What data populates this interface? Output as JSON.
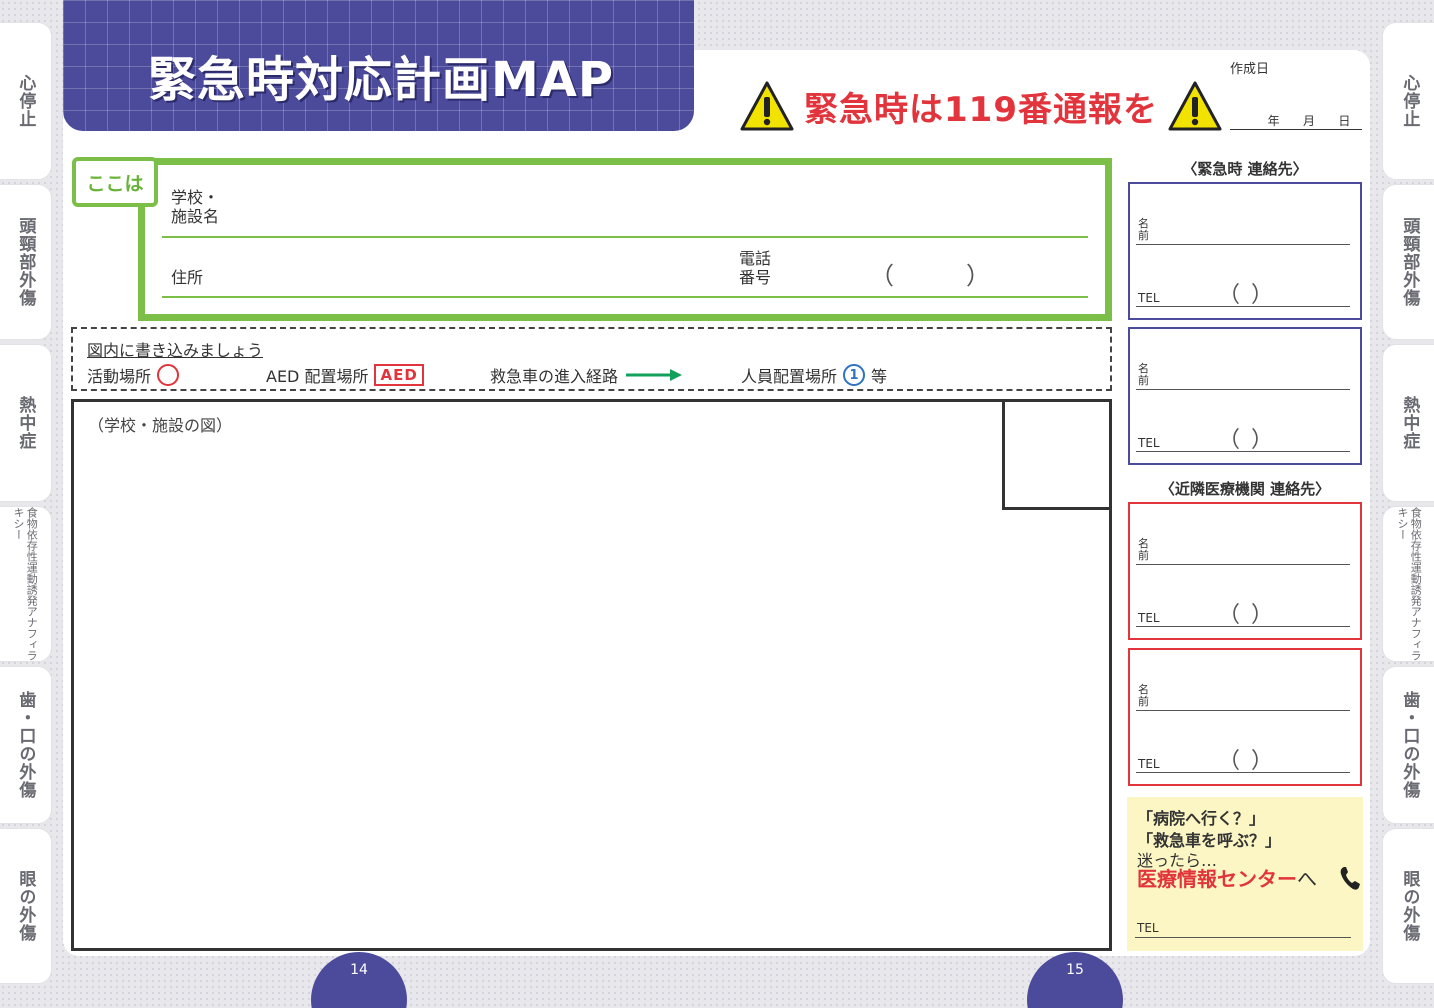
{
  "title": "緊急時対応計画MAP",
  "warning_text": "緊急時は119番通報を",
  "created_label": "作成日",
  "date_units": [
    "年",
    "月",
    "日"
  ],
  "left_tabs": [
    "心停止",
    "頭頸部外傷",
    "熱中症",
    "食物依存性運動誘発アナフィラキシー",
    "歯・口の外傷",
    "眼の外傷"
  ],
  "right_tabs": [
    "心停止",
    "頭頸部外傷",
    "熱中症",
    "食物依存性運動誘発アナフィラキシー",
    "歯・口の外傷",
    "眼の外傷"
  ],
  "location": {
    "tag": "ここは",
    "school_label_1": "学校・",
    "school_label_2": "施設名",
    "address_label": "住所",
    "phone_label_1": "電話",
    "phone_label_2": "番号",
    "phone_paren_open": "（",
    "phone_paren_close": "）"
  },
  "legend": {
    "title": "図内に書き込みましょう",
    "activity": "活動場所",
    "aed_place": "AED 配置場所",
    "aed_badge": "AED",
    "ambulance_route": "救急車の進入経路",
    "staff_place": "人員配置場所",
    "staff_number": "1",
    "staff_suffix": "等"
  },
  "map_label": "（学校・施設の図）",
  "emergency_contacts_heading": "〈緊急時 連絡先〉",
  "medical_contacts_heading": "〈近隣医療機関 連絡先〉",
  "contact_box": {
    "name_label": "名前",
    "tel_label": "TEL",
    "tel_paren": "（ ）"
  },
  "info_center": {
    "line1": "「病院へ行く？」",
    "line2": "「救急車を呼ぶ？」",
    "line3": "迷ったら…",
    "red_text": "医療情報センター",
    "red_suffix": "へ",
    "tel_label": "TEL"
  },
  "page_numbers": [
    "14",
    "15"
  ],
  "colors": {
    "header_navy": "#4b4a9b",
    "warning_red": "#e2343c",
    "location_green": "#7bbe48",
    "info_yellow": "#fbf6c4"
  }
}
